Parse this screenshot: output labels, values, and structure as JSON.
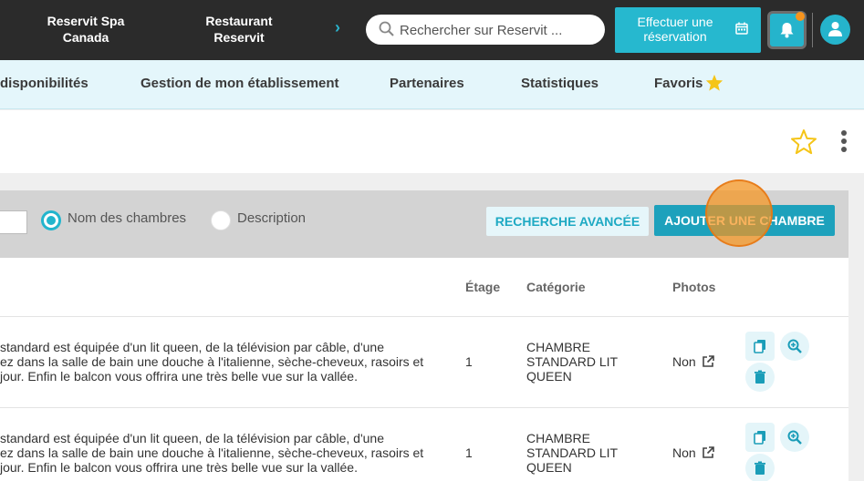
{
  "topbar": {
    "links": [
      "Reservit Spa Canada",
      "Restaurant Reservit"
    ],
    "search_placeholder": "Rechercher sur Reservit ...",
    "reserve_button": "Effectuer une réservation"
  },
  "nav": {
    "items": [
      "disponibilités",
      "Gestion de mon établissement",
      "Partenaires",
      "Statistiques",
      "Favoris"
    ]
  },
  "filter": {
    "radio_names": "Nom des chambres",
    "radio_description": "Description",
    "selected": "Nom des chambres",
    "advanced_search": "RECHERCHE AVANCÉE",
    "add_room": "AJOUTER UNE CHAMBRE"
  },
  "table": {
    "headers": {
      "etage": "Étage",
      "categorie": "Catégorie",
      "photos": "Photos"
    },
    "rows": [
      {
        "description": "standard est équipée d'un lit queen, de la télévision par câble, d'une\nez dans la salle de bain une douche à l'italienne, sèche-cheveux, rasoirs et\njour. Enfin le balcon vous offrira une très belle vue sur la vallée.",
        "etage": "1",
        "categorie": "CHAMBRE\nSTANDARD LIT\nQUEEN",
        "photos": "Non"
      },
      {
        "description": "standard est équipée d'un lit queen, de la télévision par câble, d'une\nez dans la salle de bain une douche à l'italienne, sèche-cheveux, rasoirs et\njour. Enfin le balcon vous offrira une très belle vue sur la vallée.",
        "etage": "1",
        "categorie": "CHAMBRE\nSTANDARD LIT\nQUEEN",
        "photos": "Non"
      }
    ]
  },
  "colors": {
    "accent": "#26b8cf",
    "topbar": "#2b2b2b",
    "nav_bg": "#e4f6fb",
    "notification_dot": "#f7941d",
    "favorite_star": "#f5c518"
  },
  "icons": [
    "search-icon",
    "calendar-icon",
    "bell-icon",
    "user-icon",
    "star-icon",
    "kebab-menu-icon",
    "external-link-icon",
    "copy-icon",
    "zoom-icon",
    "trash-icon"
  ]
}
